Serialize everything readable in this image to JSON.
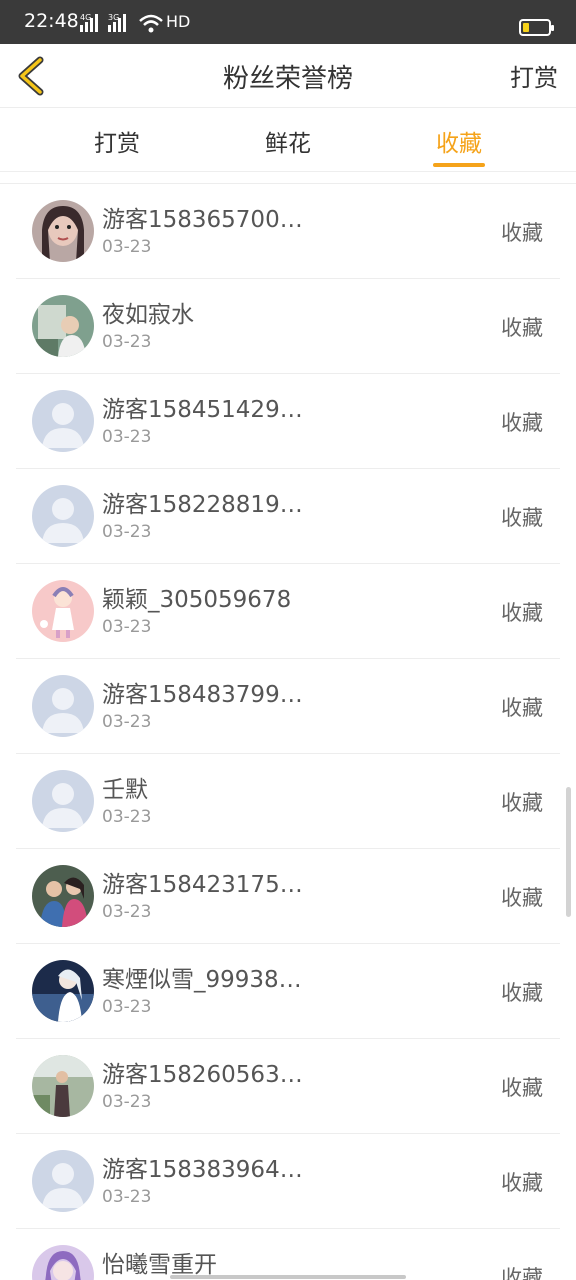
{
  "status_bar": {
    "time": "22:48",
    "network_labels": [
      "4G",
      "3G"
    ],
    "hd_label": "HD",
    "battery_color": "#f6d21a"
  },
  "header": {
    "back_icon": "chevron-left-icon",
    "title": "粉丝荣誉榜",
    "action_label": "打赏",
    "accent_color": "#f5c518"
  },
  "tabs": {
    "active_color": "#f5a31a",
    "items": [
      {
        "label": "打赏",
        "active": false
      },
      {
        "label": "鲜花",
        "active": false
      },
      {
        "label": "收藏",
        "active": true
      }
    ]
  },
  "fans": [
    {
      "name": "游客158365700…",
      "date": "03-23",
      "action": "收藏",
      "avatar": "photo-avatar"
    },
    {
      "name": "夜如寂水",
      "date": "03-23",
      "action": "收藏",
      "avatar": "photo-avatar"
    },
    {
      "name": "游客158451429…",
      "date": "03-23",
      "action": "收藏",
      "avatar": "default-avatar"
    },
    {
      "name": "游客158228819…",
      "date": "03-23",
      "action": "收藏",
      "avatar": "default-avatar"
    },
    {
      "name": "颖颖_305059678",
      "date": "03-23",
      "action": "收藏",
      "avatar": "illustration-avatar"
    },
    {
      "name": "游客158483799…",
      "date": "03-23",
      "action": "收藏",
      "avatar": "default-avatar"
    },
    {
      "name": "壬默",
      "date": "03-23",
      "action": "收藏",
      "avatar": "default-avatar"
    },
    {
      "name": "游客158423175…",
      "date": "03-23",
      "action": "收藏",
      "avatar": "photo-avatar"
    },
    {
      "name": "寒煙似雪_99938…",
      "date": "03-23",
      "action": "收藏",
      "avatar": "illustration-avatar"
    },
    {
      "name": "游客158260563…",
      "date": "03-23",
      "action": "收藏",
      "avatar": "photo-avatar"
    },
    {
      "name": "游客158383964…",
      "date": "03-23",
      "action": "收藏",
      "avatar": "default-avatar"
    },
    {
      "name": "怡曦雪重开",
      "date": "",
      "action": "收藏",
      "avatar": "illustration-avatar"
    }
  ]
}
